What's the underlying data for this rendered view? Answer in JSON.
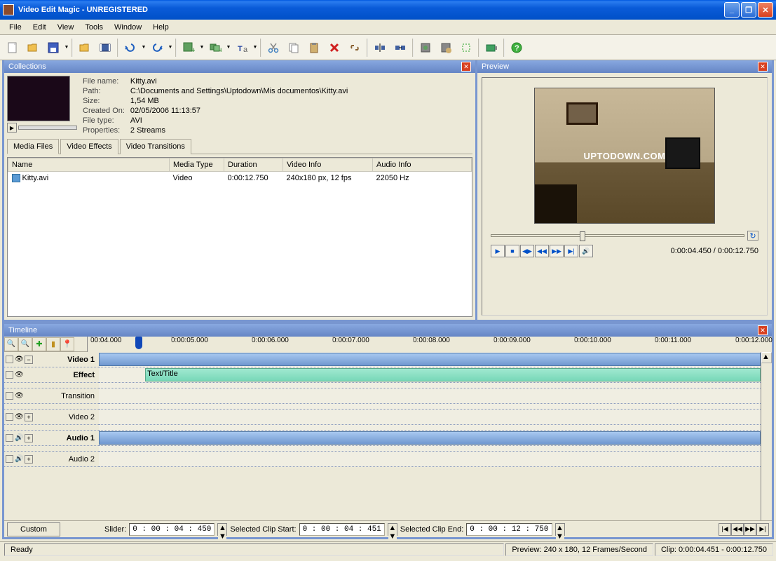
{
  "window": {
    "title": "Video Edit Magic - UNREGISTERED"
  },
  "menubar": [
    "File",
    "Edit",
    "View",
    "Tools",
    "Window",
    "Help"
  ],
  "collections": {
    "title": "Collections",
    "info": {
      "labels": [
        "File name:",
        "Path:",
        "Size:",
        "Created On:",
        "File type:",
        "Properties:"
      ],
      "values": [
        "Kitty.avi",
        "C:\\Documents and Settings\\Uptodown\\Mis documentos\\Kitty.avi",
        "1,54 MB",
        "02/05/2006 11:13:57",
        "AVI",
        "2 Streams"
      ]
    },
    "tabs": [
      "Media Files",
      "Video Effects",
      "Video Transitions"
    ],
    "columns": [
      "Name",
      "Media Type",
      "Duration",
      "Video Info",
      "Audio Info"
    ],
    "rows": [
      {
        "name": "Kitty.avi",
        "media_type": "Video",
        "duration": "0:00:12.750",
        "video_info": "240x180 px, 12 fps",
        "audio_info": "22050 Hz"
      }
    ]
  },
  "preview": {
    "title": "Preview",
    "watermark": "UPTODOWN.COM",
    "current_time": "0:00:04.450",
    "total_time": "0:00:12.750",
    "time_display": "0:00:04.450 / 0:00:12.750",
    "slider_pct": 35
  },
  "timeline": {
    "title": "Timeline",
    "ruler": [
      "00:04.000",
      "0:00:05.000",
      "0:00:06.000",
      "0:00:07.000",
      "0:00:08.000",
      "0:00:09.000",
      "0:00:10.000",
      "0:00:11.000",
      "0:00:12.000"
    ],
    "playhead_pct": 7,
    "tracks": [
      {
        "name": "Video 1",
        "type": "video",
        "bold": true
      },
      {
        "name": "Effect",
        "type": "effect",
        "bold": true
      },
      {
        "name": "Transition",
        "type": "transition"
      },
      {
        "name": "Video 2",
        "type": "video2"
      },
      {
        "name": "Audio 1",
        "type": "audio",
        "bold": true
      },
      {
        "name": "Audio 2",
        "type": "audio2"
      }
    ],
    "effect_clip_label": "Text/Title",
    "slider": {
      "label": "Slider:",
      "value": "0 : 00 : 04 : 450"
    },
    "sel_start": {
      "label": "Selected Clip Start:",
      "value": "0 : 00 : 04 : 451"
    },
    "sel_end": {
      "label": "Selected Clip End:",
      "value": "0 : 00 : 12 : 750"
    },
    "custom": "Custom"
  },
  "statusbar": {
    "ready": "Ready",
    "preview": "Preview: 240 x 180, 12 Frames/Second",
    "clip": "Clip: 0:00:04.451 - 0:00:12.750"
  }
}
